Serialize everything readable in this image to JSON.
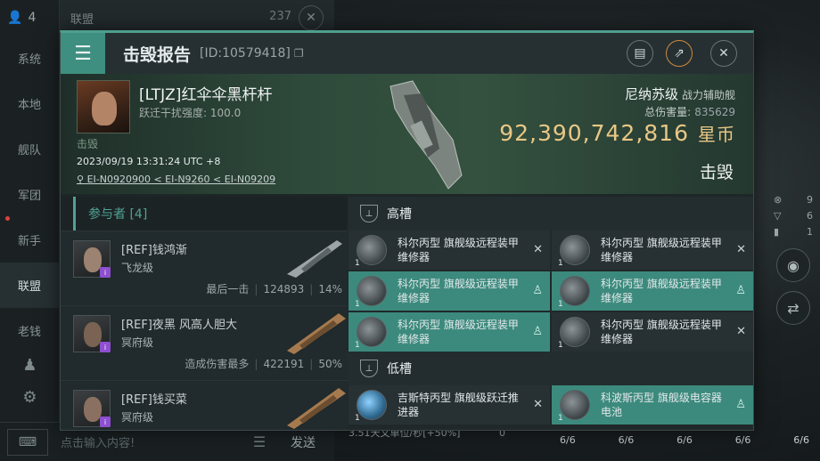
{
  "background": {
    "player_count": "4",
    "alliance_tab": "联盟",
    "alliance_count": "237",
    "sidebar": [
      "系统",
      "本地",
      "舰队",
      "军团",
      "新手",
      "联盟",
      "老钱"
    ],
    "active_sidebar": "联盟",
    "chat_placeholder": "点击输入内容!",
    "send_label": "发送",
    "hud_counts": [
      "9",
      "6",
      "1"
    ],
    "speed_text": "3.51天文单位/秒[+50%]",
    "speed_zero": "0",
    "slot_counters": [
      "6/6",
      "6/6",
      "6/6",
      "6/6",
      "6/6"
    ]
  },
  "modal": {
    "title": "击毁报告",
    "report_id": "[ID:10579418]",
    "victim": {
      "name": "[LTJZ]红伞伞黑杆杆",
      "warp_label": "跃迁干扰强度: 100.0",
      "status": "击毁",
      "datetime": "2023/09/19 13:31:24 UTC +8",
      "location": "EI-N0920900 < EI-N9260 < EI-N09209"
    },
    "ship": {
      "name": "尼纳苏级",
      "class": "战力辅助舰",
      "total_damage_label": "总伤害量:",
      "total_damage": "835629",
      "isk_value": "92,390,742,816",
      "isk_unit": "星币",
      "result": "击毁"
    },
    "participants": {
      "label": "参与者 [4]",
      "items": [
        {
          "name": "[REF]钱鸿渐",
          "ship": "飞龙级",
          "tag": "最后一击",
          "damage": "124893",
          "pct": "14%"
        },
        {
          "name": "[REF]夜黑 风高人胆大",
          "ship": "冥府级",
          "tag": "造成伤害最多",
          "damage": "422191",
          "pct": "50%"
        },
        {
          "name": "[REF]钱买菜",
          "ship": "冥府级",
          "tag": "",
          "damage": "",
          "pct": ""
        }
      ]
    },
    "high_slots": {
      "label": "高槽",
      "items": [
        {
          "name": "科尔丙型 旗舰级远程装甲维修器",
          "qty": "1",
          "state": "destroyed"
        },
        {
          "name": "科尔丙型 旗舰级远程装甲维修器",
          "qty": "1",
          "state": "destroyed"
        },
        {
          "name": "科尔丙型 旗舰级远程装甲维修器",
          "qty": "1",
          "state": "dropped"
        },
        {
          "name": "科尔丙型 旗舰级远程装甲维修器",
          "qty": "1",
          "state": "dropped"
        },
        {
          "name": "科尔丙型 旗舰级远程装甲维修器",
          "qty": "1",
          "state": "dropped"
        },
        {
          "name": "科尔丙型 旗舰级远程装甲维修器",
          "qty": "1",
          "state": "destroyed"
        }
      ]
    },
    "low_slots": {
      "label": "低槽",
      "items": [
        {
          "name": "吉斯特丙型 旗舰级跃迁推进器",
          "qty": "1",
          "state": "destroyed"
        },
        {
          "name": "科波斯丙型 旗舰级电容器电池",
          "qty": "1",
          "state": "dropped"
        }
      ]
    }
  },
  "colors": {
    "accent": "#3e8f80",
    "isk": "#e9c785",
    "participants": "#4fa395"
  }
}
